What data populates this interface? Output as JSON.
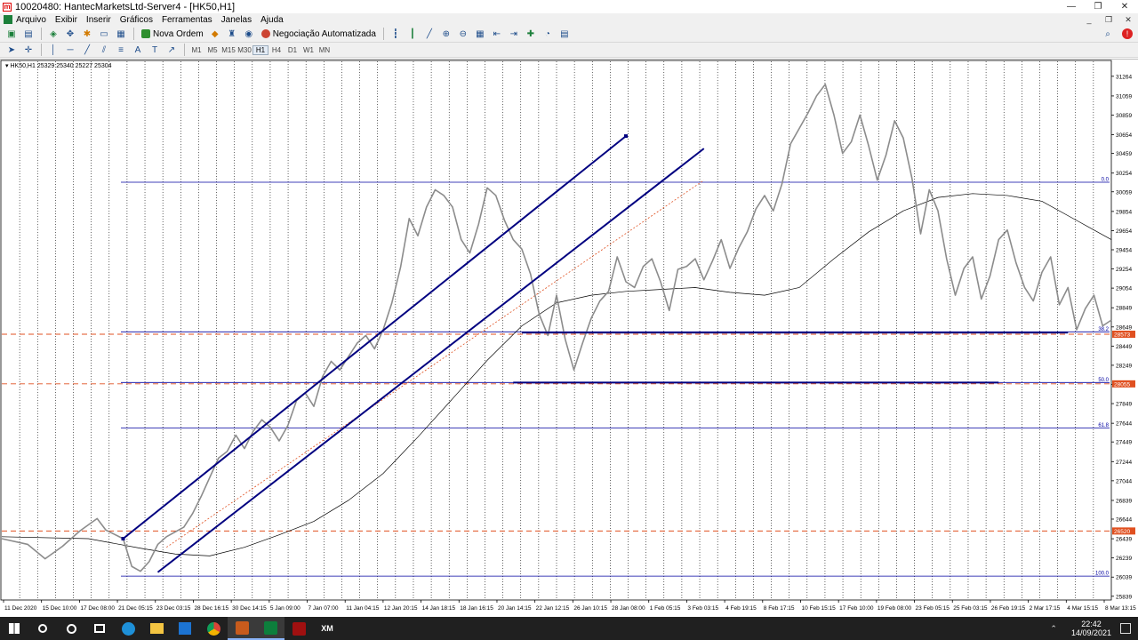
{
  "window": {
    "title": "10020480: HantecMarketsLtd-Server4 - [HK50,H1]",
    "min_label": "—",
    "max_label": "❐",
    "close_label": "✕"
  },
  "menu": [
    {
      "label": "Arquivo"
    },
    {
      "label": "Exibir"
    },
    {
      "label": "Inserir"
    },
    {
      "label": "Gráficos"
    },
    {
      "label": "Ferramentas"
    },
    {
      "label": "Janelas"
    },
    {
      "label": "Ajuda"
    }
  ],
  "toolbar": {
    "new_order_label": "Nova Ordem",
    "auto_trading_label": "Negociação Automatizada",
    "timeframes": [
      "M1",
      "M5",
      "M15",
      "M30",
      "H1",
      "H4",
      "D1",
      "W1",
      "MN"
    ],
    "active_timeframe": "H1",
    "alert_count": "!"
  },
  "chart": {
    "info": "HK50,H1  25329 25340 25227 25304",
    "colors": {
      "background": "#ffffff",
      "price": "#8c8c8c",
      "channel": "#000080",
      "fib": "#0000a0",
      "dashed": "#e05020",
      "ma": "#000000",
      "grid": "#000000"
    }
  },
  "chart_data": {
    "type": "line",
    "symbol": "HK50",
    "timeframe": "H1",
    "ohlc_header": {
      "open": 25329,
      "high": 25340,
      "low": 25227,
      "close": 25304
    },
    "y_ticks": [
      31264,
      31059,
      30859,
      30654,
      30459,
      30254,
      30059,
      29854,
      29654,
      29454,
      29254,
      29054,
      28849,
      28649,
      28449,
      28249,
      28049,
      27849,
      27644,
      27449,
      27244,
      27044,
      26839,
      26644,
      26439,
      26239,
      26039,
      25839
    ],
    "x_ticks": [
      "11 Dec 2020",
      "15 Dec 10:00",
      "17 Dec 08:00",
      "21 Dec 05:15",
      "23 Dec 03:15",
      "28 Dec 16:15",
      "30 Dec 14:15",
      "5 Jan 09:00",
      "7 Jan 07:00",
      "11 Jan 04:15",
      "12 Jan 20:15",
      "14 Jan 18:15",
      "18 Jan 16:15",
      "20 Jan 14:15",
      "22 Jan 12:15",
      "26 Jan 10:15",
      "28 Jan 08:00",
      "1 Feb 05:15",
      "3 Feb 03:15",
      "4 Feb 19:15",
      "8 Feb 17:15",
      "10 Feb 15:15",
      "17 Feb 10:00",
      "19 Feb 08:00",
      "23 Feb 05:15",
      "25 Feb 03:15",
      "26 Feb 19:15",
      "2 Mar 17:15",
      "4 Mar 15:15",
      "8 Mar 13:15"
    ],
    "price_path": [
      [
        0,
        26440
      ],
      [
        3,
        26380
      ],
      [
        5,
        26230
      ],
      [
        7,
        26360
      ],
      [
        9,
        26520
      ],
      [
        11,
        26650
      ],
      [
        12,
        26530
      ],
      [
        14,
        26440
      ],
      [
        15,
        26150
      ],
      [
        16,
        26100
      ],
      [
        17,
        26200
      ],
      [
        18,
        26380
      ],
      [
        19,
        26460
      ],
      [
        21,
        26560
      ],
      [
        22,
        26700
      ],
      [
        23,
        26880
      ],
      [
        24,
        27080
      ],
      [
        25,
        27280
      ],
      [
        26,
        27350
      ],
      [
        27,
        27520
      ],
      [
        28,
        27380
      ],
      [
        29,
        27560
      ],
      [
        30,
        27680
      ],
      [
        31,
        27600
      ],
      [
        32,
        27460
      ],
      [
        33,
        27620
      ],
      [
        34,
        27880
      ],
      [
        35,
        27960
      ],
      [
        36,
        27820
      ],
      [
        37,
        28130
      ],
      [
        38,
        28290
      ],
      [
        39,
        28200
      ],
      [
        40,
        28340
      ],
      [
        41,
        28480
      ],
      [
        42,
        28560
      ],
      [
        43,
        28420
      ],
      [
        44,
        28620
      ],
      [
        45,
        28900
      ],
      [
        46,
        29270
      ],
      [
        47,
        29780
      ],
      [
        48,
        29600
      ],
      [
        49,
        29900
      ],
      [
        50,
        30080
      ],
      [
        51,
        30020
      ],
      [
        52,
        29900
      ],
      [
        53,
        29560
      ],
      [
        54,
        29420
      ],
      [
        55,
        29720
      ],
      [
        56,
        30100
      ],
      [
        57,
        30020
      ],
      [
        58,
        29760
      ],
      [
        59,
        29560
      ],
      [
        60,
        29460
      ],
      [
        61,
        29200
      ],
      [
        62,
        28780
      ],
      [
        63,
        28560
      ],
      [
        64,
        28980
      ],
      [
        65,
        28520
      ],
      [
        66,
        28200
      ],
      [
        67,
        28480
      ],
      [
        68,
        28740
      ],
      [
        69,
        28920
      ],
      [
        70,
        29020
      ],
      [
        71,
        29380
      ],
      [
        72,
        29120
      ],
      [
        73,
        29060
      ],
      [
        74,
        29280
      ],
      [
        75,
        29360
      ],
      [
        76,
        29120
      ],
      [
        77,
        28820
      ],
      [
        78,
        29250
      ],
      [
        79,
        29280
      ],
      [
        80,
        29360
      ],
      [
        81,
        29140
      ],
      [
        82,
        29340
      ],
      [
        83,
        29560
      ],
      [
        84,
        29260
      ],
      [
        85,
        29470
      ],
      [
        86,
        29640
      ],
      [
        87,
        29880
      ],
      [
        88,
        30020
      ],
      [
        89,
        29860
      ],
      [
        90,
        30140
      ],
      [
        91,
        30560
      ],
      [
        92,
        30720
      ],
      [
        93,
        30880
      ],
      [
        94,
        31060
      ],
      [
        95,
        31180
      ],
      [
        96,
        30860
      ],
      [
        97,
        30460
      ],
      [
        98,
        30580
      ],
      [
        99,
        30860
      ],
      [
        100,
        30540
      ],
      [
        101,
        30180
      ],
      [
        102,
        30440
      ],
      [
        103,
        30800
      ],
      [
        104,
        30620
      ],
      [
        105,
        30200
      ],
      [
        106,
        29620
      ],
      [
        107,
        30080
      ],
      [
        108,
        29860
      ],
      [
        109,
        29360
      ],
      [
        110,
        28980
      ],
      [
        111,
        29260
      ],
      [
        112,
        29380
      ],
      [
        113,
        28940
      ],
      [
        114,
        29180
      ],
      [
        115,
        29560
      ],
      [
        116,
        29660
      ],
      [
        117,
        29320
      ],
      [
        118,
        29060
      ],
      [
        119,
        28920
      ],
      [
        120,
        29220
      ],
      [
        121,
        29380
      ],
      [
        122,
        28880
      ],
      [
        123,
        29060
      ],
      [
        124,
        28620
      ],
      [
        125,
        28840
      ],
      [
        126,
        28980
      ],
      [
        127,
        28660
      ],
      [
        128,
        28720
      ]
    ],
    "moving_average": [
      [
        0,
        26460
      ],
      [
        10,
        26440
      ],
      [
        16,
        26340
      ],
      [
        20,
        26280
      ],
      [
        24,
        26260
      ],
      [
        28,
        26350
      ],
      [
        32,
        26480
      ],
      [
        36,
        26620
      ],
      [
        40,
        26840
      ],
      [
        44,
        27120
      ],
      [
        48,
        27500
      ],
      [
        52,
        27900
      ],
      [
        56,
        28300
      ],
      [
        60,
        28660
      ],
      [
        64,
        28900
      ],
      [
        68,
        28980
      ],
      [
        72,
        29020
      ],
      [
        76,
        29040
      ],
      [
        80,
        29060
      ],
      [
        84,
        29010
      ],
      [
        88,
        28980
      ],
      [
        92,
        29060
      ],
      [
        96,
        29360
      ],
      [
        100,
        29640
      ],
      [
        104,
        29860
      ],
      [
        108,
        30000
      ],
      [
        112,
        30040
      ],
      [
        116,
        30020
      ],
      [
        120,
        29960
      ],
      [
        124,
        29760
      ],
      [
        128,
        29560
      ]
    ],
    "channel_lines": [
      {
        "from": [
          14,
          26440
        ],
        "to": [
          72,
          30640
        ]
      },
      {
        "from": [
          18,
          26090
        ],
        "to": [
          81,
          30510
        ]
      }
    ],
    "fib_levels": [
      {
        "label": "0.0",
        "value": 30159
      },
      {
        "label": "38.2",
        "value": 28598
      },
      {
        "label": "50.0",
        "value": 28069
      },
      {
        "label": "61.8",
        "value": 27596
      },
      {
        "label": "100.0",
        "value": 26049
      }
    ],
    "horizontal_lines": [
      {
        "value": 28590,
        "from": 60,
        "to": 123
      },
      {
        "value": 28069,
        "from": 59,
        "to": 115
      }
    ],
    "price_labels": [
      {
        "text": "28573",
        "value": 28573
      },
      {
        "text": "28055",
        "value": 28055
      },
      {
        "text": "26520",
        "value": 26520
      }
    ],
    "ylim": [
      25800,
      31420
    ],
    "xlim": [
      0,
      128
    ],
    "grid": true
  },
  "taskbar": {
    "time": "22:42",
    "date": "14/09/2021"
  }
}
